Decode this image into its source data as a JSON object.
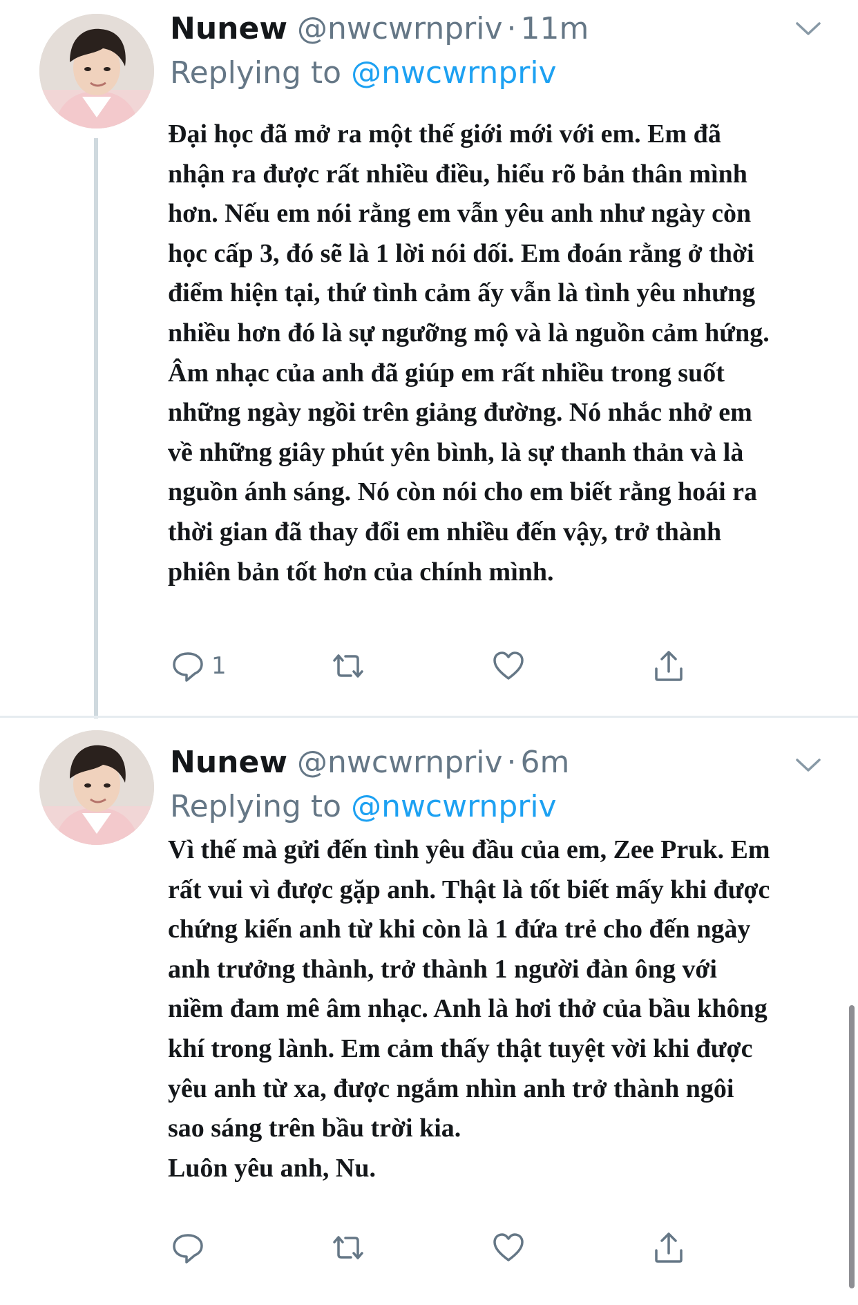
{
  "colors": {
    "text_primary": "#14171a",
    "text_secondary": "#657786",
    "link": "#1da1f2",
    "thread_line": "#cfd9de",
    "icon": "#657786"
  },
  "tweets": [
    {
      "display_name": "Nunew",
      "handle": "@nwcwrnpriv",
      "separator": "·",
      "time": "11m",
      "replying_prefix": "Replying to",
      "replying_to": "@nwcwrnpriv",
      "text": "Đại học đã mở ra một thế giới mới với em. Em đã nhận ra được rất nhiều điều, hiểu rõ bản thân mình hơn. Nếu em nói rằng em vẫn yêu anh như ngày còn học cấp 3, đó sẽ là 1 lời nói dối. Em đoán rằng ở thời điểm hiện tại, thứ tình cảm ấy vẫn là tình yêu nhưng nhiều hơn đó là sự ngưỡng mộ và là nguồn cảm hứng. Âm nhạc của anh đã giúp em rất nhiều trong suốt những ngày ngồi trên giảng đường. Nó nhắc nhở em về những giây phút yên bình, là sự thanh thản và là nguồn ánh sáng. Nó còn nói cho em biết rằng hoái ra thời gian đã thay đổi em nhiều đến vậy, trở thành phiên bản tốt hơn của chính mình.",
      "reply_count": "1",
      "icons": [
        "reply-icon",
        "retweet-icon",
        "like-icon",
        "share-icon",
        "chevron-down-icon"
      ]
    },
    {
      "display_name": "Nunew",
      "handle": "@nwcwrnpriv",
      "separator": "·",
      "time": "6m",
      "replying_prefix": "Replying to",
      "replying_to": "@nwcwrnpriv",
      "text": "Vì thế mà gửi đến tình yêu đầu của em, Zee Pruk. Em rất vui vì được gặp anh. Thật là tốt biết mấy khi được chứng kiến anh từ khi còn là 1 đứa trẻ cho đến ngày anh trưởng thành, trở thành 1 người đàn ông với niềm đam mê âm nhạc. Anh là hơi thở của bầu không khí trong lành. Em cảm thấy thật tuyệt vời khi được yêu anh từ xa, được ngắm nhìn anh trở thành ngôi sao sáng trên bầu trời kia.\nLuôn yêu anh, Nu.",
      "reply_count": "",
      "icons": [
        "reply-icon",
        "retweet-icon",
        "like-icon",
        "share-icon",
        "chevron-down-icon"
      ]
    }
  ]
}
